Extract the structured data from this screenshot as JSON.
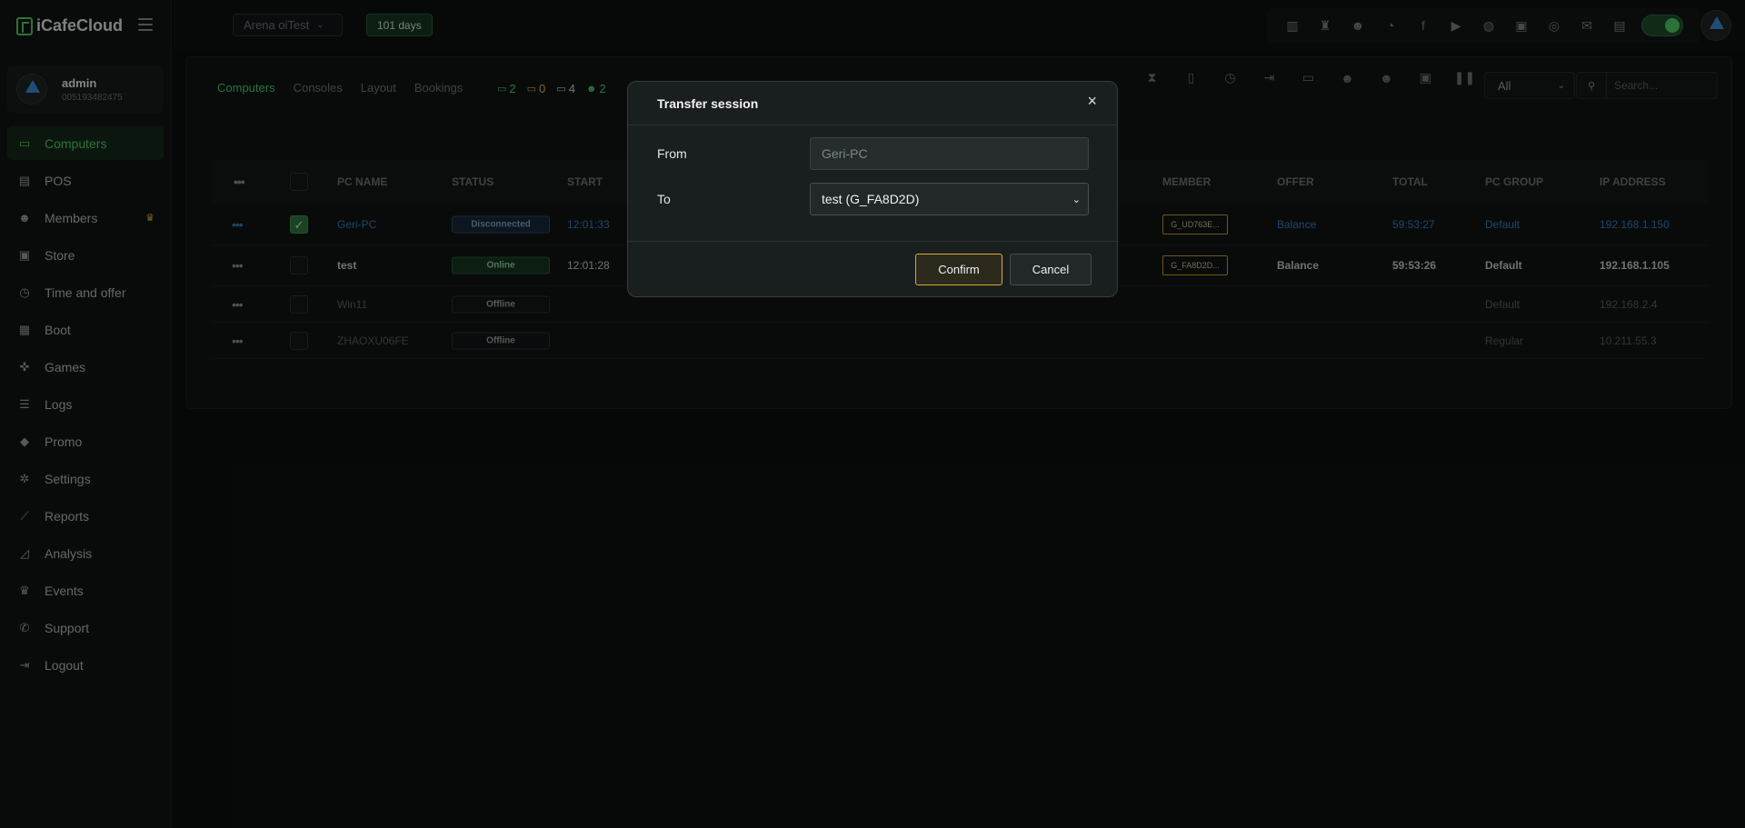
{
  "app": {
    "logo_text": "iCafeCloud"
  },
  "profile": {
    "name": "admin",
    "id": "005193482475"
  },
  "sidebar": {
    "items": [
      {
        "label": "Computers",
        "icon": "monitor-icon",
        "glyph": "▭",
        "active": true
      },
      {
        "label": "POS",
        "icon": "pos-icon",
        "glyph": "▤"
      },
      {
        "label": "Members",
        "icon": "members-icon",
        "glyph": "☻",
        "badge": "♛"
      },
      {
        "label": "Store",
        "icon": "store-icon",
        "glyph": "▣"
      },
      {
        "label": "Time and offer",
        "icon": "clock-icon",
        "glyph": "◷"
      },
      {
        "label": "Boot",
        "icon": "windows-icon",
        "glyph": "▦"
      },
      {
        "label": "Games",
        "icon": "gamepad-icon",
        "glyph": "✜"
      },
      {
        "label": "Logs",
        "icon": "list-icon",
        "glyph": "☰"
      },
      {
        "label": "Promo",
        "icon": "tag-icon",
        "glyph": "◆"
      },
      {
        "label": "Settings",
        "icon": "gear-icon",
        "glyph": "✲"
      },
      {
        "label": "Reports",
        "icon": "chart-line-icon",
        "glyph": "⟋"
      },
      {
        "label": "Analysis",
        "icon": "chart-area-icon",
        "glyph": "◿"
      },
      {
        "label": "Events",
        "icon": "crown-icon",
        "glyph": "♛"
      },
      {
        "label": "Support",
        "icon": "phone-icon",
        "glyph": "✆"
      },
      {
        "label": "Logout",
        "icon": "logout-icon",
        "glyph": "⇥"
      }
    ]
  },
  "topbar": {
    "shop_name": "Arena oiTest",
    "days_badge": "101 days",
    "icons": [
      {
        "name": "leaderboard-icon",
        "glyph": "▥"
      },
      {
        "name": "trophy-icon",
        "glyph": "♜"
      },
      {
        "name": "users-icon",
        "glyph": "☻"
      },
      {
        "name": "rss-icon",
        "glyph": "◔"
      },
      {
        "name": "facebook-icon",
        "glyph": "f"
      },
      {
        "name": "youtube-icon",
        "glyph": "▶"
      },
      {
        "name": "globe-icon",
        "glyph": "◍"
      },
      {
        "name": "icafe-icon",
        "glyph": "▣"
      },
      {
        "name": "eye-slash-icon",
        "glyph": "◎"
      },
      {
        "name": "mail-icon",
        "glyph": "✉"
      },
      {
        "name": "chat-icon",
        "glyph": "▤"
      }
    ]
  },
  "panel": {
    "tabs": [
      {
        "label": "Computers",
        "active": true
      },
      {
        "label": "Consoles"
      },
      {
        "label": "Layout"
      },
      {
        "label": "Bookings"
      }
    ],
    "counts": [
      {
        "value": "2",
        "color": "green",
        "glyph": "▭"
      },
      {
        "value": "0",
        "color": "yellow",
        "glyph": "▭"
      },
      {
        "value": "4",
        "color": "white",
        "glyph": "▭"
      },
      {
        "value": "2",
        "color": "green",
        "glyph": "☻"
      }
    ],
    "tools": [
      {
        "name": "hourglass-icon",
        "glyph": "⧗"
      },
      {
        "name": "phone-lock-icon",
        "glyph": "▯"
      },
      {
        "name": "alarm-icon",
        "glyph": "◷"
      },
      {
        "name": "sign-out-icon",
        "glyph": "⇥"
      },
      {
        "name": "money-icon",
        "glyph": "▭"
      },
      {
        "name": "user-add-icon",
        "glyph": "☻"
      },
      {
        "name": "user-transfer-icon",
        "glyph": "☻"
      },
      {
        "name": "screenshot-icon",
        "glyph": "▣"
      },
      {
        "name": "pause-icon",
        "glyph": "❚❚"
      }
    ],
    "filter": {
      "selected": "All"
    },
    "search": {
      "placeholder": "Search..."
    }
  },
  "table": {
    "headers": {
      "pc_name": "PC NAME",
      "status": "STATUS",
      "start": "START",
      "member": "MEMBER",
      "offer": "OFFER",
      "total": "TOTAL",
      "pc_group": "PC GROUP",
      "ip": "IP ADDRESS"
    },
    "rows": [
      {
        "name": "Geri-PC",
        "status": "Disconnected",
        "start": "12:01:33",
        "member": "G_UD763E...",
        "offer": "Balance",
        "total": "59:53:27",
        "group": "Default",
        "ip": "192.168.1.150"
      },
      {
        "name": "test",
        "status": "Online",
        "start": "12:01:28",
        "member": "G_FA8D2D...",
        "offer": "Balance",
        "total": "59:53:26",
        "group": "Default",
        "ip": "192.168.1.105"
      },
      {
        "name": "Win11",
        "status": "Offline",
        "group": "Default",
        "ip": "192.168.2.4"
      },
      {
        "name": "ZHAOXU06FE",
        "status": "Offline",
        "group": "Regular",
        "ip": "10.211.55.3"
      }
    ]
  },
  "modal": {
    "title": "Transfer session",
    "close": "×",
    "from_label": "From",
    "from_value": "Geri-PC",
    "to_label": "To",
    "to_value": "test (G_FA8D2D)",
    "confirm": "Confirm",
    "cancel": "Cancel"
  }
}
